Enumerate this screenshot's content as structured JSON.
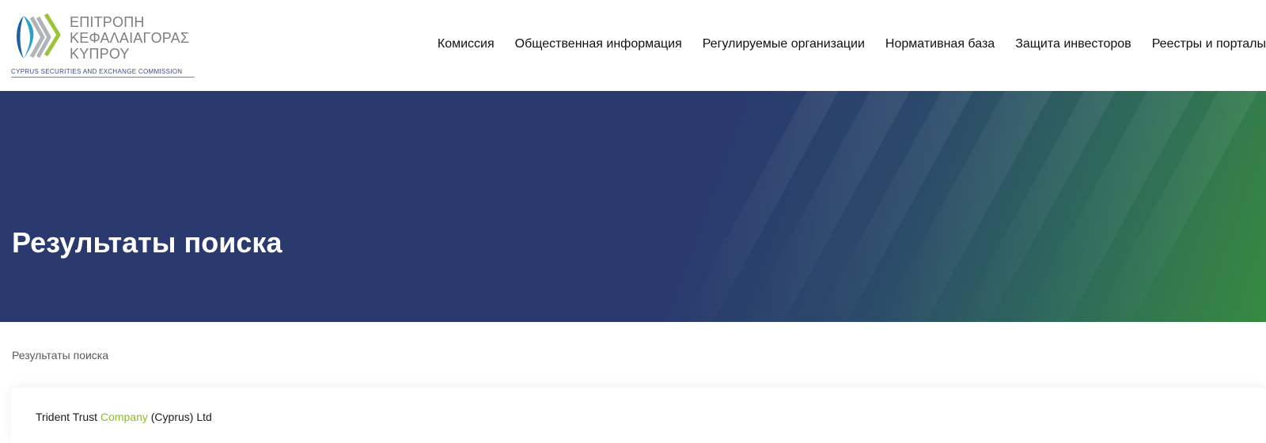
{
  "logo": {
    "line1": "ΕΠΙΤΡΟΠΗ",
    "line2": "ΚΕΦΑΛΑΙΑΓΟΡΑΣ",
    "line3": "ΚΥΠΡΟΥ",
    "subtitle": "CYPRUS SECURITIES AND EXCHANGE COMMISSION",
    "icon": "cysec-chevrons-logo"
  },
  "nav": {
    "items": [
      {
        "label": "Комиссия"
      },
      {
        "label": "Общественная информация"
      },
      {
        "label": "Регулируемые организации"
      },
      {
        "label": "Нормативная база"
      },
      {
        "label": "Защита инвесторов"
      },
      {
        "label": "Реестры и порталы"
      }
    ]
  },
  "hero": {
    "title": "Результаты поиска"
  },
  "breadcrumb": {
    "current": "Результаты поиска"
  },
  "results": {
    "items": [
      {
        "before": "Trident Trust ",
        "match": "Company",
        "after": " (Cyprus) Ltd"
      }
    ]
  },
  "colors": {
    "hero_blue": "#2a3a6e",
    "hero_green": "#378a40",
    "highlight": "#8dbb2c",
    "logo_blue": "#1e5fa8",
    "logo_green": "#9cc43a",
    "logo_gray": "#b0b4b8"
  }
}
